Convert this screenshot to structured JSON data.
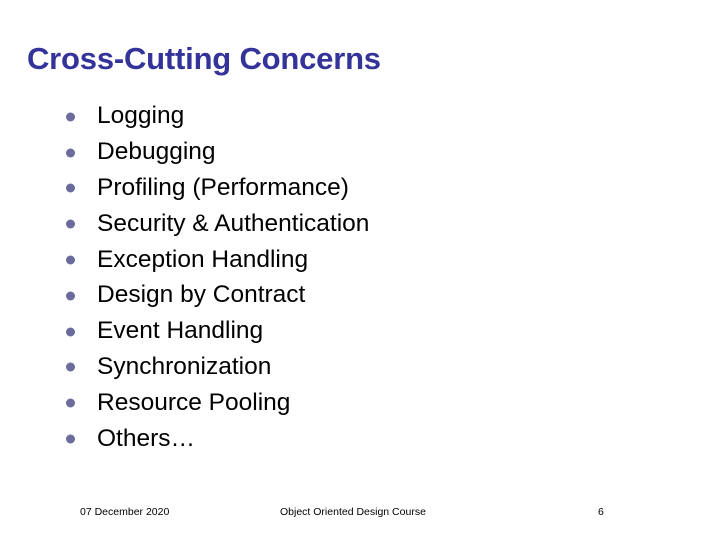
{
  "slide": {
    "title": "Cross-Cutting Concerns",
    "title_color": "#333399",
    "background_color": "#ffffff",
    "bullet_color": "#6b6b9e",
    "text_color": "#000000",
    "bullets": [
      {
        "label": "Logging"
      },
      {
        "label": "Debugging"
      },
      {
        "label": "Profiling (Performance)"
      },
      {
        "label": "Security & Authentication"
      },
      {
        "label": "Exception Handling"
      },
      {
        "label": "Design by Contract"
      },
      {
        "label": "Event Handling"
      },
      {
        "label": "Synchronization"
      },
      {
        "label": "Resource Pooling"
      },
      {
        "label": "Others…"
      }
    ],
    "footer": {
      "date": "07 December 2020",
      "course": "Object Oriented Design Course",
      "page_number": "6"
    }
  }
}
